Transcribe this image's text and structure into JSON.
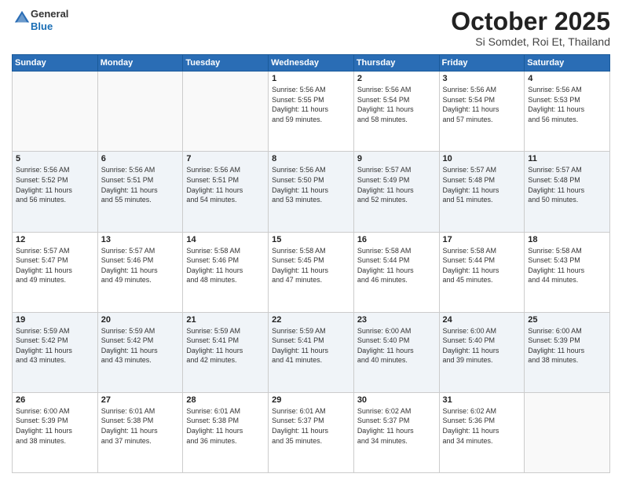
{
  "header": {
    "logo_general": "General",
    "logo_blue": "Blue",
    "month_title": "October 2025",
    "location": "Si Somdet, Roi Et, Thailand"
  },
  "days_of_week": [
    "Sunday",
    "Monday",
    "Tuesday",
    "Wednesday",
    "Thursday",
    "Friday",
    "Saturday"
  ],
  "weeks": [
    [
      {
        "day": "",
        "info": ""
      },
      {
        "day": "",
        "info": ""
      },
      {
        "day": "",
        "info": ""
      },
      {
        "day": "1",
        "info": "Sunrise: 5:56 AM\nSunset: 5:55 PM\nDaylight: 11 hours\nand 59 minutes."
      },
      {
        "day": "2",
        "info": "Sunrise: 5:56 AM\nSunset: 5:54 PM\nDaylight: 11 hours\nand 58 minutes."
      },
      {
        "day": "3",
        "info": "Sunrise: 5:56 AM\nSunset: 5:54 PM\nDaylight: 11 hours\nand 57 minutes."
      },
      {
        "day": "4",
        "info": "Sunrise: 5:56 AM\nSunset: 5:53 PM\nDaylight: 11 hours\nand 56 minutes."
      }
    ],
    [
      {
        "day": "5",
        "info": "Sunrise: 5:56 AM\nSunset: 5:52 PM\nDaylight: 11 hours\nand 56 minutes."
      },
      {
        "day": "6",
        "info": "Sunrise: 5:56 AM\nSunset: 5:51 PM\nDaylight: 11 hours\nand 55 minutes."
      },
      {
        "day": "7",
        "info": "Sunrise: 5:56 AM\nSunset: 5:51 PM\nDaylight: 11 hours\nand 54 minutes."
      },
      {
        "day": "8",
        "info": "Sunrise: 5:56 AM\nSunset: 5:50 PM\nDaylight: 11 hours\nand 53 minutes."
      },
      {
        "day": "9",
        "info": "Sunrise: 5:57 AM\nSunset: 5:49 PM\nDaylight: 11 hours\nand 52 minutes."
      },
      {
        "day": "10",
        "info": "Sunrise: 5:57 AM\nSunset: 5:48 PM\nDaylight: 11 hours\nand 51 minutes."
      },
      {
        "day": "11",
        "info": "Sunrise: 5:57 AM\nSunset: 5:48 PM\nDaylight: 11 hours\nand 50 minutes."
      }
    ],
    [
      {
        "day": "12",
        "info": "Sunrise: 5:57 AM\nSunset: 5:47 PM\nDaylight: 11 hours\nand 49 minutes."
      },
      {
        "day": "13",
        "info": "Sunrise: 5:57 AM\nSunset: 5:46 PM\nDaylight: 11 hours\nand 49 minutes."
      },
      {
        "day": "14",
        "info": "Sunrise: 5:58 AM\nSunset: 5:46 PM\nDaylight: 11 hours\nand 48 minutes."
      },
      {
        "day": "15",
        "info": "Sunrise: 5:58 AM\nSunset: 5:45 PM\nDaylight: 11 hours\nand 47 minutes."
      },
      {
        "day": "16",
        "info": "Sunrise: 5:58 AM\nSunset: 5:44 PM\nDaylight: 11 hours\nand 46 minutes."
      },
      {
        "day": "17",
        "info": "Sunrise: 5:58 AM\nSunset: 5:44 PM\nDaylight: 11 hours\nand 45 minutes."
      },
      {
        "day": "18",
        "info": "Sunrise: 5:58 AM\nSunset: 5:43 PM\nDaylight: 11 hours\nand 44 minutes."
      }
    ],
    [
      {
        "day": "19",
        "info": "Sunrise: 5:59 AM\nSunset: 5:42 PM\nDaylight: 11 hours\nand 43 minutes."
      },
      {
        "day": "20",
        "info": "Sunrise: 5:59 AM\nSunset: 5:42 PM\nDaylight: 11 hours\nand 43 minutes."
      },
      {
        "day": "21",
        "info": "Sunrise: 5:59 AM\nSunset: 5:41 PM\nDaylight: 11 hours\nand 42 minutes."
      },
      {
        "day": "22",
        "info": "Sunrise: 5:59 AM\nSunset: 5:41 PM\nDaylight: 11 hours\nand 41 minutes."
      },
      {
        "day": "23",
        "info": "Sunrise: 6:00 AM\nSunset: 5:40 PM\nDaylight: 11 hours\nand 40 minutes."
      },
      {
        "day": "24",
        "info": "Sunrise: 6:00 AM\nSunset: 5:40 PM\nDaylight: 11 hours\nand 39 minutes."
      },
      {
        "day": "25",
        "info": "Sunrise: 6:00 AM\nSunset: 5:39 PM\nDaylight: 11 hours\nand 38 minutes."
      }
    ],
    [
      {
        "day": "26",
        "info": "Sunrise: 6:00 AM\nSunset: 5:39 PM\nDaylight: 11 hours\nand 38 minutes."
      },
      {
        "day": "27",
        "info": "Sunrise: 6:01 AM\nSunset: 5:38 PM\nDaylight: 11 hours\nand 37 minutes."
      },
      {
        "day": "28",
        "info": "Sunrise: 6:01 AM\nSunset: 5:38 PM\nDaylight: 11 hours\nand 36 minutes."
      },
      {
        "day": "29",
        "info": "Sunrise: 6:01 AM\nSunset: 5:37 PM\nDaylight: 11 hours\nand 35 minutes."
      },
      {
        "day": "30",
        "info": "Sunrise: 6:02 AM\nSunset: 5:37 PM\nDaylight: 11 hours\nand 34 minutes."
      },
      {
        "day": "31",
        "info": "Sunrise: 6:02 AM\nSunset: 5:36 PM\nDaylight: 11 hours\nand 34 minutes."
      },
      {
        "day": "",
        "info": ""
      }
    ]
  ]
}
